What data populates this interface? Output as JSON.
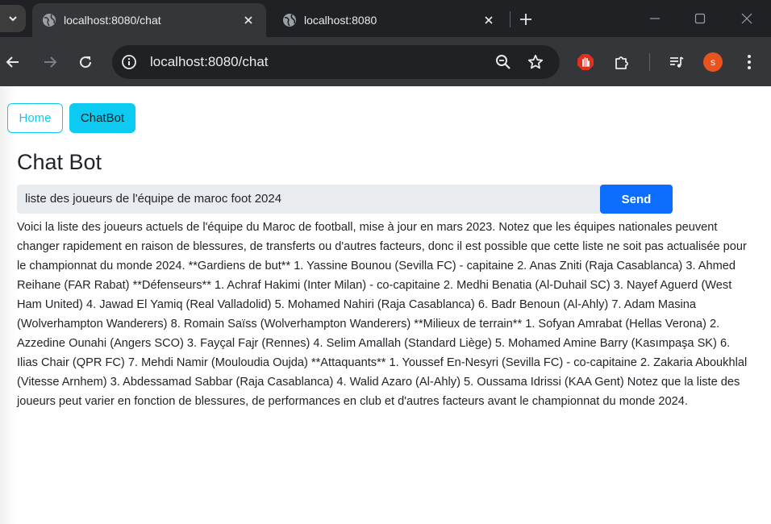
{
  "browser": {
    "tabs": [
      {
        "title": "localhost:8080/chat",
        "active": true
      },
      {
        "title": "localhost:8080",
        "active": false
      }
    ],
    "address": "localhost:8080/chat",
    "profile_initial": "s",
    "profile_color": "#e8531f"
  },
  "nav": {
    "home_label": "Home",
    "chatbot_label": "ChatBot"
  },
  "chat": {
    "title": "Chat Bot",
    "input_value": "liste des joueurs de l'équipe de maroc foot 2024",
    "send_label": "Send",
    "response": "Voici la liste des joueurs actuels de l'équipe du Maroc de football, mise à jour en mars 2023. Notez que les équipes nationales peuvent changer rapidement en raison de blessures, de transferts ou d'autres facteurs, donc il est possible que cette liste ne soit pas actualisée pour le championnat du monde 2024. **Gardiens de but** 1. Yassine Bounou (Sevilla FC) - capitaine 2. Anas Zniti (Raja Casablanca) 3. Ahmed Reihane (FAR Rabat) **Défenseurs** 1. Achraf Hakimi (Inter Milan) - co-capitaine 2. Medhi Benatia (Al-Duhail SC) 3. Nayef Aguerd (West Ham United) 4. Jawad El Yamiq (Real Valladolid) 5. Mohamed Nahiri (Raja Casablanca) 6. Badr Benoun (Al-Ahly) 7. Adam Masina (Wolverhampton Wanderers) 8. Romain Saïss (Wolverhampton Wanderers) **Milieux de terrain** 1. Sofyan Amrabat (Hellas Verona) 2. Azzedine Ounahi (Angers SCO) 3. Fayçal Fajr (Rennes) 4. Selim Amallah (Standard Liège) 5. Mohamed Amine Barry (Kasımpaşa SK) 6. Ilias Chair (QPR FC) 7. Mehdi Namir (Mouloudia Oujda) **Attaquants** 1. Youssef En-Nesyri (Sevilla FC) - co-capitaine 2. Zakaria Aboukhlal (Vitesse Arnhem) 3. Abdessamad Sabbar (Raja Casablanca) 4. Walid Azaro (Al-Ahly) 5. Oussama Idrissi (KAA Gent) Notez que la liste des joueurs peut varier en fonction de blessures, de performances en club et d'autres facteurs avant le championnat du monde 2024."
  },
  "colors": {
    "info": "#0dcaf0",
    "primary": "#0d6efd",
    "input_bg": "#e9ecef"
  }
}
